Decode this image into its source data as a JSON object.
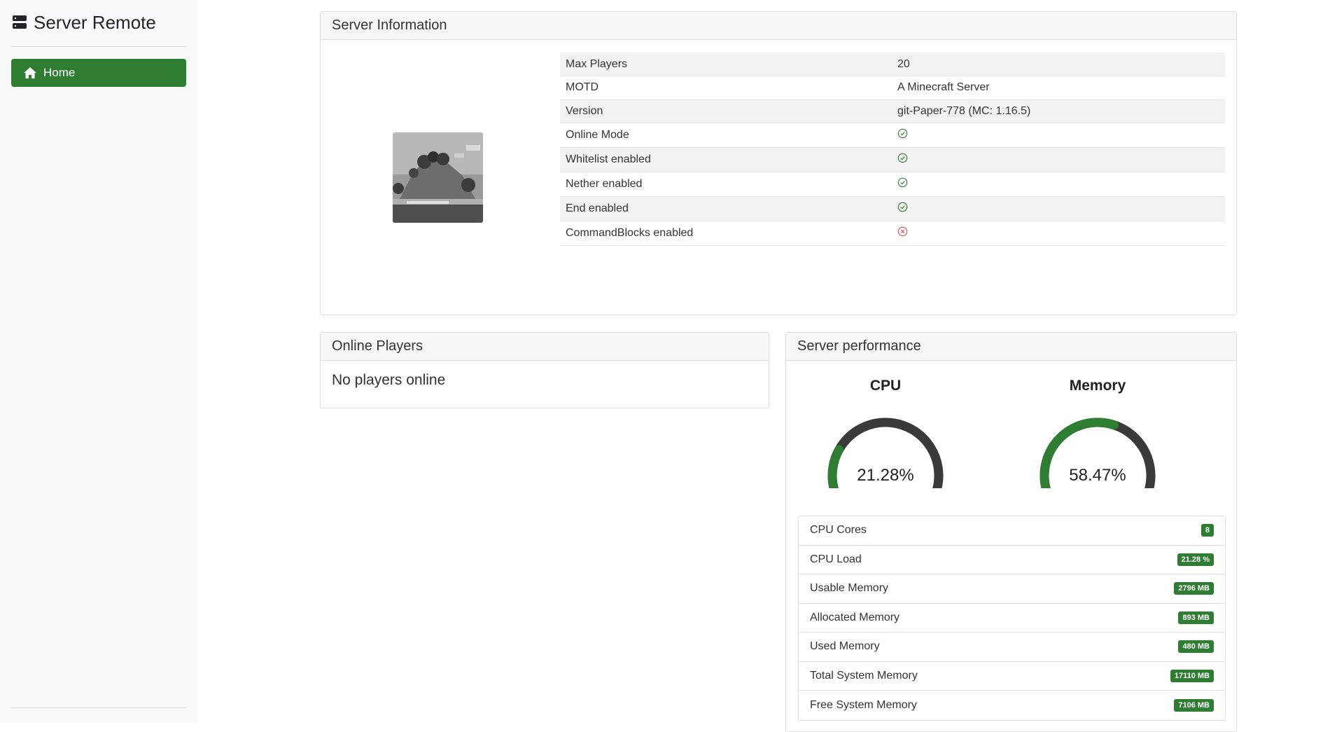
{
  "sidebar": {
    "brand": "Server Remote",
    "brand_icon": "server-icon",
    "nav": [
      {
        "label": "Home",
        "icon": "home-icon",
        "active": true
      }
    ]
  },
  "server_info": {
    "title": "Server Information",
    "image_alt": "server-icon-image",
    "rows": [
      {
        "key": "Max Players",
        "value": "20"
      },
      {
        "key": "MOTD",
        "value": "A Minecraft Server"
      },
      {
        "key": "Version",
        "value": "git-Paper-778 (MC: 1.16.5)"
      },
      {
        "key": "Online Mode",
        "status": true
      },
      {
        "key": "Whitelist enabled",
        "status": true
      },
      {
        "key": "Nether enabled",
        "status": true
      },
      {
        "key": "End enabled",
        "status": true
      },
      {
        "key": "CommandBlocks enabled",
        "status": false
      }
    ]
  },
  "players": {
    "title": "Online Players",
    "empty_text": "No players online"
  },
  "performance": {
    "title": "Server performance",
    "gauges": [
      {
        "title": "CPU",
        "value_text": "21.28%",
        "fraction": 0.2128
      },
      {
        "title": "Memory",
        "value_text": "58.47%",
        "fraction": 0.5847
      }
    ],
    "stats": [
      {
        "label": "CPU Cores",
        "value": "8"
      },
      {
        "label": "CPU Load",
        "value": "21.28 %"
      },
      {
        "label": "Usable Memory",
        "value": "2796 MB"
      },
      {
        "label": "Allocated Memory",
        "value": "893 MB"
      },
      {
        "label": "Used Memory",
        "value": "480 MB"
      },
      {
        "label": "Total System Memory",
        "value": "17110 MB"
      },
      {
        "label": "Free System Memory",
        "value": "7106 MB"
      }
    ]
  },
  "colors": {
    "accent": "#2e7d32",
    "gauge_track": "#3a3a3a",
    "ok": "#2e7d32",
    "error": "#d9534f"
  }
}
